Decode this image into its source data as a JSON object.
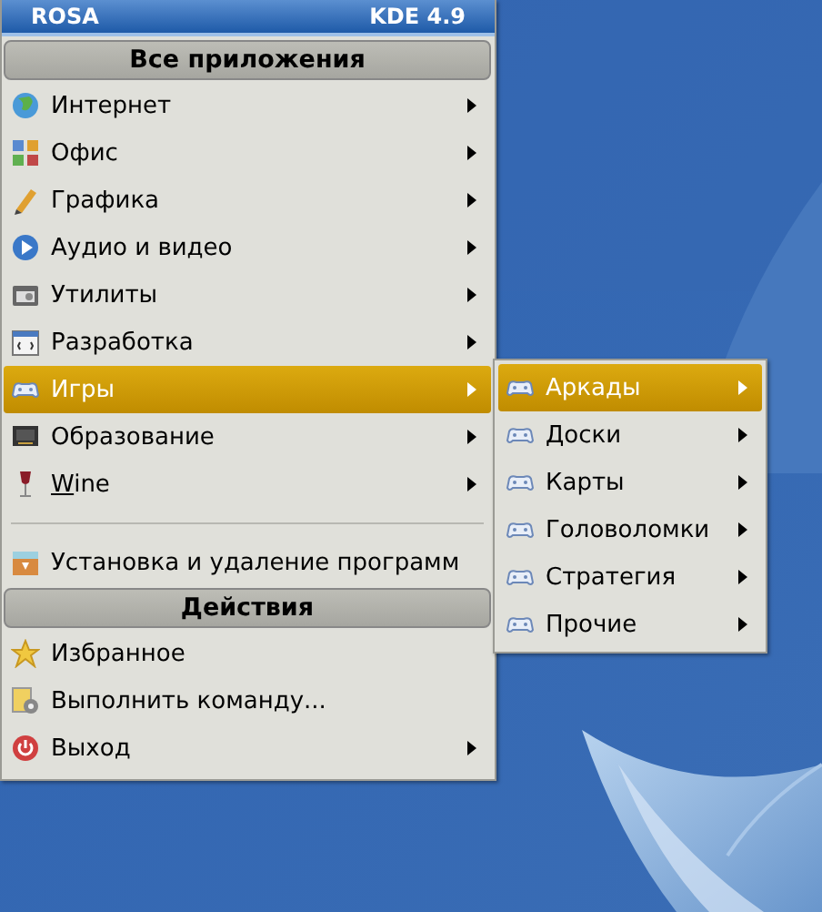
{
  "panel": {
    "distro": "ROSA",
    "version": "KDE 4.9"
  },
  "menu": {
    "sections": [
      {
        "title": "Все приложения",
        "items": [
          {
            "kind": "globe",
            "label": "Интернет",
            "submenu": true,
            "selected": false,
            "mnemonic_underlined": false
          },
          {
            "kind": "office",
            "label": "Офис",
            "submenu": true,
            "selected": false,
            "mnemonic_underlined": false
          },
          {
            "kind": "graphics",
            "label": "Графика",
            "submenu": true,
            "selected": false,
            "mnemonic_underlined": false
          },
          {
            "kind": "audio",
            "label": "Аудио и видео",
            "submenu": true,
            "selected": false,
            "mnemonic_underlined": false
          },
          {
            "kind": "utilities",
            "label": "Утилиты",
            "submenu": true,
            "selected": false,
            "mnemonic_underlined": false
          },
          {
            "kind": "development",
            "label": "Разработка",
            "submenu": true,
            "selected": false,
            "mnemonic_underlined": false
          },
          {
            "kind": "gamepad",
            "label": "Игры",
            "submenu": true,
            "selected": true,
            "mnemonic_underlined": false
          },
          {
            "kind": "education",
            "label": "Образование",
            "submenu": true,
            "selected": false,
            "mnemonic_underlined": false
          },
          {
            "kind": "wine",
            "label": "Wine",
            "submenu": true,
            "selected": false,
            "mnemonic_underlined": true
          },
          {
            "kind": "separator"
          },
          {
            "kind": "installer",
            "label": "Установка и удаление программ",
            "submenu": false,
            "selected": false,
            "mnemonic_underlined": false
          }
        ]
      },
      {
        "title": "Действия",
        "items": [
          {
            "kind": "star",
            "label": "Избранное",
            "submenu": false,
            "selected": false,
            "mnemonic_underlined": false
          },
          {
            "kind": "run",
            "label": "Выполнить команду...",
            "submenu": false,
            "selected": false,
            "mnemonic_underlined": false
          },
          {
            "kind": "power",
            "label": "Выход",
            "submenu": true,
            "selected": false,
            "mnemonic_underlined": false
          }
        ]
      }
    ]
  },
  "submenu": {
    "items": [
      {
        "kind": "gamepad",
        "label": "Аркады",
        "submenu": true,
        "selected": true,
        "mnemonic_underlined": false
      },
      {
        "kind": "gamepad",
        "label": "Доски",
        "submenu": true,
        "selected": false,
        "mnemonic_underlined": false
      },
      {
        "kind": "gamepad",
        "label": "Карты",
        "submenu": true,
        "selected": false,
        "mnemonic_underlined": false
      },
      {
        "kind": "gamepad",
        "label": "Головоломки",
        "submenu": true,
        "selected": false,
        "mnemonic_underlined": false
      },
      {
        "kind": "gamepad",
        "label": "Стратегия",
        "submenu": true,
        "selected": false,
        "mnemonic_underlined": false
      },
      {
        "kind": "gamepad",
        "label": "Прочие",
        "submenu": true,
        "selected": false,
        "mnemonic_underlined": false
      }
    ]
  }
}
